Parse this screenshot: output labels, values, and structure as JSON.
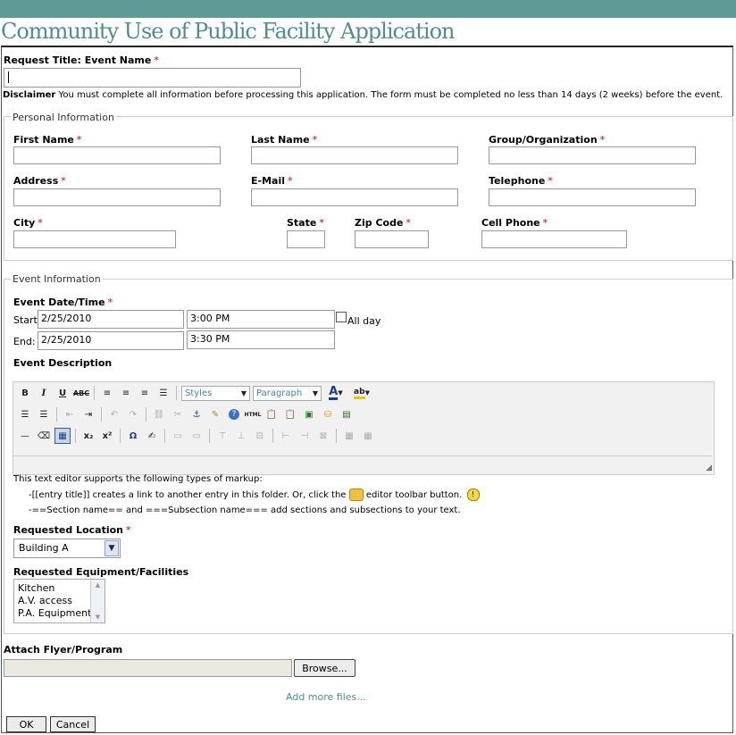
{
  "page_title": "Community Use of Public Facility Application",
  "request_title": {
    "label": "Request Title: Event Name",
    "value": ""
  },
  "disclaimer": {
    "label": "Disclaimer",
    "text": "You must complete all information before processing this application. The form must be completed no less than 14 days (2 weeks) before the event."
  },
  "personal": {
    "legend": "Personal Information",
    "first_name": {
      "label": "First Name",
      "value": ""
    },
    "last_name": {
      "label": "Last Name",
      "value": ""
    },
    "group": {
      "label": "Group/Organization",
      "value": ""
    },
    "address": {
      "label": "Address",
      "value": ""
    },
    "email": {
      "label": "E-Mail",
      "value": ""
    },
    "telephone": {
      "label": "Telephone",
      "value": ""
    },
    "city": {
      "label": "City",
      "value": ""
    },
    "state": {
      "label": "State",
      "value": ""
    },
    "zip": {
      "label": "Zip Code",
      "value": ""
    },
    "cell": {
      "label": "Cell Phone",
      "value": ""
    }
  },
  "event": {
    "legend": "Event Information",
    "datetime_label": "Event Date/Time",
    "start_label": "Start:",
    "start_date": "2/25/2010",
    "start_time": "3:00 PM",
    "all_day_label": "All day",
    "all_day_checked": false,
    "end_label": "End:",
    "end_date": "2/25/2010",
    "end_time": "3:30 PM",
    "description_label": "Event Description",
    "editor": {
      "styles_dropdown": "Styles",
      "paragraph_dropdown": "Paragraph",
      "row1": [
        "bold-icon",
        "italic-icon",
        "underline-icon",
        "strikethrough-icon",
        "align-left-icon",
        "align-center-icon",
        "align-right-icon",
        "justify-icon"
      ],
      "row2": [
        "bullet-list-icon",
        "numbered-list-icon",
        "outdent-icon",
        "indent-icon",
        "undo-icon",
        "redo-icon",
        "link-icon",
        "unlink-icon",
        "anchor-icon",
        "cleanup-icon",
        "help-icon",
        "html-icon",
        "paste-text-icon",
        "paste-word-icon",
        "insert-image-icon",
        "insert-entry-icon",
        "insert-media-icon"
      ],
      "row3": [
        "horizontal-rule-icon",
        "remove-format-icon",
        "table-icon",
        "subscript-icon",
        "superscript-icon",
        "special-char-icon",
        "edit-icon"
      ]
    },
    "markup_help": {
      "intro": "This text editor supports the following types of markup:",
      "line1": "-[[entry title]] creates a link to another entry in this folder. Or, click the",
      "line1_suffix": "editor toolbar button.",
      "line2": "-==Section name== and ===Subsection name=== add sections and subsections to your text."
    },
    "location_label": "Requested Location",
    "location_value": "Building A",
    "equipment_label": "Requested Equipment/Facilities",
    "equipment_options": [
      "Kitchen",
      "A.V. access",
      "P.A. Equipment"
    ]
  },
  "attach": {
    "label": "Attach Flyer/Program",
    "browse": "Browse...",
    "add_more": "Add more files..."
  },
  "buttons": {
    "ok": "OK",
    "cancel": "Cancel"
  },
  "colors": {
    "brand": "#5f9a97",
    "title": "#4f8e8b",
    "required": "#cc0000"
  }
}
